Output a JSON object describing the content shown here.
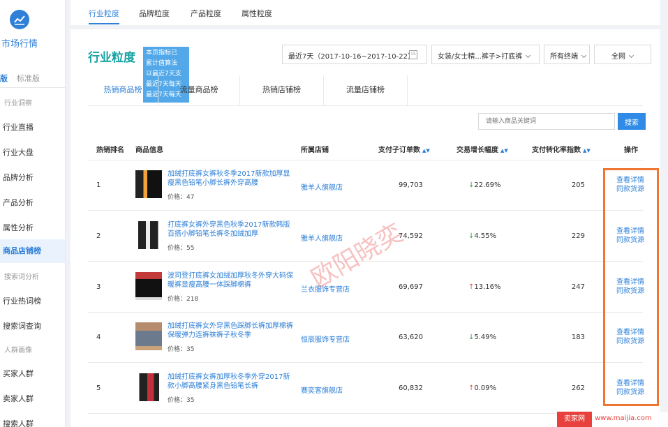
{
  "sidebar": {
    "title": "市场行情",
    "editions": [
      "版",
      "标准版"
    ],
    "items": [
      {
        "label": "行业洞察",
        "section": true
      },
      {
        "label": "行业直播"
      },
      {
        "label": "行业大盘"
      },
      {
        "label": "品牌分析"
      },
      {
        "label": "产品分析"
      },
      {
        "label": "属性分析"
      },
      {
        "label": "商品店铺榜",
        "active": true
      },
      {
        "label": "搜索词分析",
        "section": true
      },
      {
        "label": "行业热词榜"
      },
      {
        "label": "搜索词查询"
      },
      {
        "label": "人群画像",
        "section": true
      },
      {
        "label": "买家人群"
      },
      {
        "label": "卖家人群"
      },
      {
        "label": "搜索人群"
      }
    ]
  },
  "top_tabs": [
    "行业粒度",
    "品牌粒度",
    "产品粒度",
    "属性粒度"
  ],
  "main": {
    "title": "行业粒度",
    "tip_lines": [
      "本页指标已",
      "累计值算法",
      "以最近7天支",
      "最近7天每天",
      "最近7天每天"
    ],
    "date_range": "最近7天（2017-10-16~2017-10-22）",
    "calendar_day": "15",
    "category": "女装/女士精...裤子>打底裤",
    "terminal": "所有终端",
    "network": "全网"
  },
  "sub_tabs": [
    "热销商品榜",
    "流量商品榜",
    "热销店铺榜",
    "流量店铺榜"
  ],
  "search": {
    "placeholder": "请输入商品关键词",
    "button": "搜索"
  },
  "table": {
    "headers": [
      "热销排名",
      "商品信息",
      "所属店铺",
      "支付子订单数",
      "交易增长幅度",
      "支付转化率指数",
      "操作"
    ],
    "action_detail": "查看详情",
    "action_source": "同款货源",
    "rows": [
      {
        "rank": "1",
        "name": "加绒打底裤女裤秋冬季2017新款加厚显瘦黑色铅笔小脚长裤外穿高腰",
        "price": "价格：47",
        "shop": "雅羊人旗舰店",
        "orders": "99,703",
        "growth": "22.69%",
        "trend": "down",
        "conversion": "205"
      },
      {
        "rank": "2",
        "name": "打底裤女裤外穿黑色秋季2017新款韩版百搭小脚铅笔长裤冬加绒加厚",
        "price": "价格：55",
        "shop": "雅羊人旗舰店",
        "orders": "74,592",
        "growth": "4.55%",
        "trend": "down",
        "conversion": "229"
      },
      {
        "rank": "3",
        "name": "波司登打底裤女加绒加厚秋冬外穿大码保暖裤显瘦高腰一体踩脚棉裤",
        "price": "价格：218",
        "shop": "兰衣服饰专营店",
        "orders": "69,697",
        "growth": "13.16%",
        "trend": "up",
        "conversion": "247"
      },
      {
        "rank": "4",
        "name": "加绒打底裤女外穿黑色踩脚长裤加厚棉裤保暖弹力连裤袜裤子秋冬季",
        "price": "价格：35",
        "shop": "恒辰服饰专营店",
        "orders": "63,620",
        "growth": "5.49%",
        "trend": "down",
        "conversion": "183"
      },
      {
        "rank": "5",
        "name": "加绒打底裤女裤加厚秋冬季外穿2017新款小脚高腰紧身黑色铅笔长裤",
        "price": "价格：35",
        "shop": "赛奕客旗舰店",
        "orders": "60,832",
        "growth": "0.09%",
        "trend": "up",
        "conversion": "262"
      }
    ]
  },
  "watermark": "欧阳晓奕",
  "brand": {
    "mark": "卖家网",
    "url": "www.maijia.com"
  }
}
